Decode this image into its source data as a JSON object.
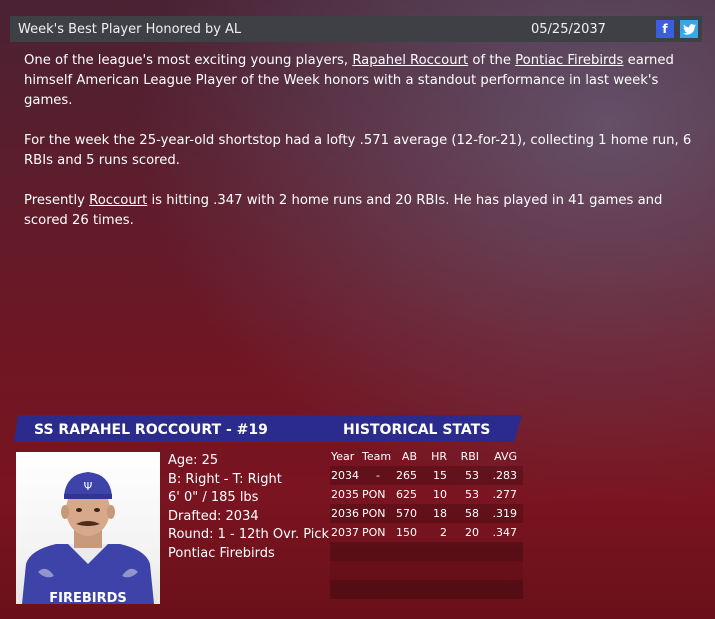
{
  "header": {
    "title": "Week's Best Player Honored by AL",
    "date": "05/25/2037",
    "facebook_icon": "f",
    "twitter_icon": "twitter-bird"
  },
  "article": {
    "p1_pre": "One of the league's most exciting young players, ",
    "player_link": "Rapahel Roccourt",
    "p1_mid": " of the ",
    "team_link": "Pontiac Firebirds",
    "p1_post": " earned himself American League Player of the Week honors with a standout performance in last week's games.",
    "p2": "For the week the 25-year-old shortstop had a lofty .571 average (12-for-21), collecting 1 home run, 6 RBIs and 5 runs scored.",
    "p3_pre": "Presently ",
    "p3_link": "Roccourt",
    "p3_post": " is hitting .347 with 2 home runs and 20 RBIs. He has played in 41 games and scored 26 times."
  },
  "player": {
    "header": "SS RAPAHEL ROCCOURT - #19",
    "age": "Age: 25",
    "bats_throws": "B: Right - T: Right",
    "size": "6' 0\" / 185 lbs",
    "drafted": "Drafted: 2034",
    "round": "Round: 1 - 12th Ovr. Pick",
    "team": "Pontiac Firebirds",
    "jersey_text": "FIREBIRDS"
  },
  "stats": {
    "header": "HISTORICAL STATS",
    "columns": [
      "Year",
      "Team",
      "AB",
      "HR",
      "RBI",
      "AVG"
    ],
    "rows": [
      [
        "2034",
        "-",
        "265",
        "15",
        "53",
        ".283"
      ],
      [
        "2035",
        "PON",
        "625",
        "10",
        "53",
        ".277"
      ],
      [
        "2036",
        "PON",
        "570",
        "18",
        "58",
        ".319"
      ],
      [
        "2037",
        "PON",
        "150",
        "2",
        "20",
        ".347"
      ]
    ]
  },
  "colors": {
    "header_bar": "#3e4046",
    "player_bar": "#2a2b8c",
    "facebook": "#3b5ee0",
    "twitter": "#3aa6e6"
  }
}
